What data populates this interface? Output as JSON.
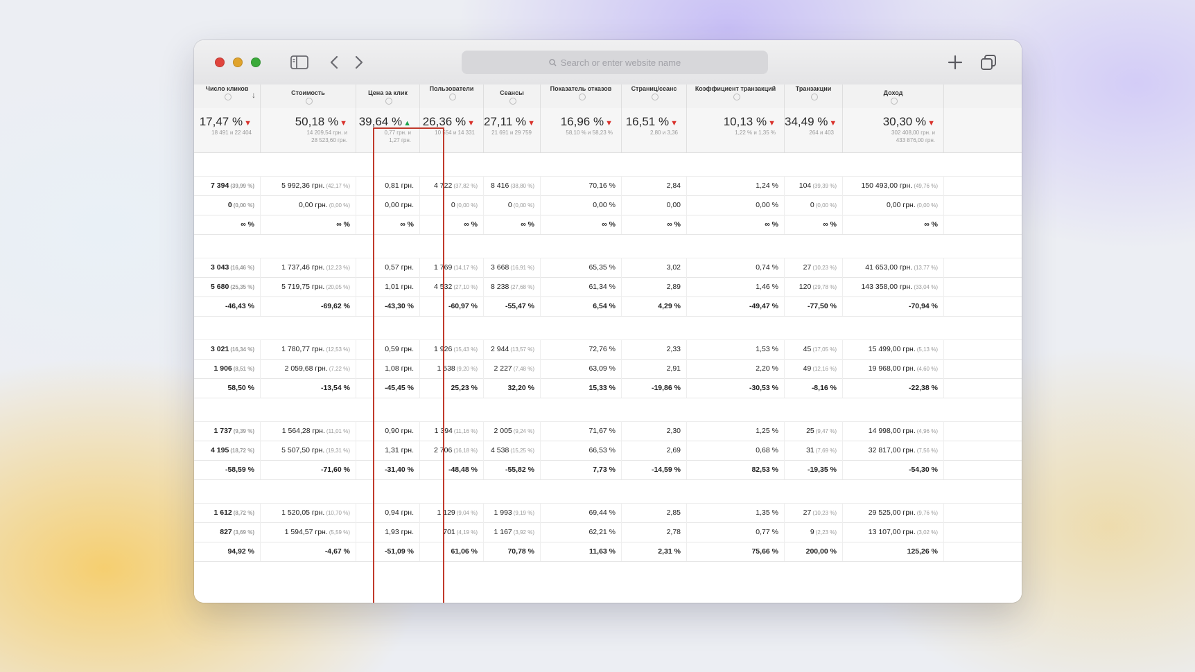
{
  "browser": {
    "address_placeholder": "Search or enter website name",
    "icons": [
      "sidebar-icon",
      "back-icon",
      "forward-icon",
      "plus-icon",
      "tabs-icon",
      "search-icon"
    ]
  },
  "table": {
    "columns": [
      {
        "key": "clicks",
        "label": "Число кликов"
      },
      {
        "key": "cost",
        "label": "Стоимость"
      },
      {
        "key": "cpc",
        "label": "Цена за клик"
      },
      {
        "key": "users",
        "label": "Пользователи"
      },
      {
        "key": "sessions",
        "label": "Сеансы"
      },
      {
        "key": "bounce",
        "label": "Показатель отказов"
      },
      {
        "key": "pages",
        "label": "Страниц/сеанс"
      },
      {
        "key": "conv",
        "label": "Коэффициент транзакций"
      },
      {
        "key": "trans",
        "label": "Транзакции"
      },
      {
        "key": "revenue",
        "label": "Доход"
      }
    ],
    "summary": [
      {
        "pct": "17,47 %",
        "dir": "down",
        "sub": [
          "18 491 и 22 404"
        ]
      },
      {
        "pct": "50,18 %",
        "dir": "down",
        "sub": [
          "14 209,54 грн. и",
          "28 523,60 грн."
        ]
      },
      {
        "pct": "39,64 %",
        "dir": "up",
        "sub": [
          "0,77 грн. и",
          "1,27 грн."
        ]
      },
      {
        "pct": "26,36 %",
        "dir": "down",
        "sub": [
          "10 554 и 14 331"
        ]
      },
      {
        "pct": "27,11 %",
        "dir": "down",
        "sub": [
          "21 691 и 29 759"
        ]
      },
      {
        "pct": "16,96 %",
        "dir": "down",
        "sub": [
          "58,10 % и 58,23 %"
        ]
      },
      {
        "pct": "16,51 %",
        "dir": "down",
        "sub": [
          "2,80 и 3,36"
        ]
      },
      {
        "pct": "10,13 %",
        "dir": "down",
        "sub": [
          "1,22 % и 1,35 %"
        ]
      },
      {
        "pct": "34,49 %",
        "dir": "down",
        "sub": [
          "264 и 403"
        ]
      },
      {
        "pct": "30,30 %",
        "dir": "down",
        "sub": [
          "302 408,00 грн. и",
          "433 876,00 грн."
        ]
      }
    ],
    "groups": [
      {
        "rows": [
          [
            [
              "7 394",
              "(39,99 %)"
            ],
            [
              "5 992,36 грн.",
              "(42,17 %)"
            ],
            [
              "0,81 грн.",
              ""
            ],
            [
              "4 722",
              "(37,82 %)"
            ],
            [
              "8 416",
              "(38,80 %)"
            ],
            [
              "70,16 %",
              ""
            ],
            [
              "2,84",
              ""
            ],
            [
              "1,24 %",
              ""
            ],
            [
              "104",
              "(39,39 %)"
            ],
            [
              "150 493,00 грн.",
              "(49,76 %)"
            ]
          ],
          [
            [
              "0",
              "(0,00 %)"
            ],
            [
              "0,00 грн.",
              "(0,00 %)"
            ],
            [
              "0,00 грн.",
              ""
            ],
            [
              "0",
              "(0,00 %)"
            ],
            [
              "0",
              "(0,00 %)"
            ],
            [
              "0,00 %",
              ""
            ],
            [
              "0,00",
              ""
            ],
            [
              "0,00 %",
              ""
            ],
            [
              "0",
              "(0,00 %)"
            ],
            [
              "0,00 грн.",
              "(0,00 %)"
            ]
          ],
          [
            [
              "∞ %",
              ""
            ],
            [
              "∞ %",
              ""
            ],
            [
              "∞ %",
              ""
            ],
            [
              "∞ %",
              ""
            ],
            [
              "∞ %",
              ""
            ],
            [
              "∞ %",
              ""
            ],
            [
              "∞ %",
              ""
            ],
            [
              "∞ %",
              ""
            ],
            [
              "∞ %",
              ""
            ],
            [
              "∞ %",
              ""
            ]
          ]
        ]
      },
      {
        "rows": [
          [
            [
              "3 043",
              "(16,46 %)"
            ],
            [
              "1 737,46 грн.",
              "(12,23 %)"
            ],
            [
              "0,57 грн.",
              ""
            ],
            [
              "1 769",
              "(14,17 %)"
            ],
            [
              "3 668",
              "(16,91 %)"
            ],
            [
              "65,35 %",
              ""
            ],
            [
              "3,02",
              ""
            ],
            [
              "0,74 %",
              ""
            ],
            [
              "27",
              "(10,23 %)"
            ],
            [
              "41 653,00 грн.",
              "(13,77 %)"
            ]
          ],
          [
            [
              "5 680",
              "(25,35 %)"
            ],
            [
              "5 719,75 грн.",
              "(20,05 %)"
            ],
            [
              "1,01 грн.",
              ""
            ],
            [
              "4 532",
              "(27,10 %)"
            ],
            [
              "8 238",
              "(27,68 %)"
            ],
            [
              "61,34 %",
              ""
            ],
            [
              "2,89",
              ""
            ],
            [
              "1,46 %",
              ""
            ],
            [
              "120",
              "(29,78 %)"
            ],
            [
              "143 358,00 грн.",
              "(33,04 %)"
            ]
          ],
          [
            [
              "-46,43 %",
              ""
            ],
            [
              "-69,62 %",
              ""
            ],
            [
              "-43,30 %",
              ""
            ],
            [
              "-60,97 %",
              ""
            ],
            [
              "-55,47 %",
              ""
            ],
            [
              "6,54 %",
              ""
            ],
            [
              "4,29 %",
              ""
            ],
            [
              "-49,47 %",
              ""
            ],
            [
              "-77,50 %",
              ""
            ],
            [
              "-70,94 %",
              ""
            ]
          ]
        ]
      },
      {
        "rows": [
          [
            [
              "3 021",
              "(16,34 %)"
            ],
            [
              "1 780,77 грн.",
              "(12,53 %)"
            ],
            [
              "0,59 грн.",
              ""
            ],
            [
              "1 926",
              "(15,43 %)"
            ],
            [
              "2 944",
              "(13,57 %)"
            ],
            [
              "72,76 %",
              ""
            ],
            [
              "2,33",
              ""
            ],
            [
              "1,53 %",
              ""
            ],
            [
              "45",
              "(17,05 %)"
            ],
            [
              "15 499,00 грн.",
              "(5,13 %)"
            ]
          ],
          [
            [
              "1 906",
              "(8,51 %)"
            ],
            [
              "2 059,68 грн.",
              "(7,22 %)"
            ],
            [
              "1,08 грн.",
              ""
            ],
            [
              "1 538",
              "(9,20 %)"
            ],
            [
              "2 227",
              "(7,48 %)"
            ],
            [
              "63,09 %",
              ""
            ],
            [
              "2,91",
              ""
            ],
            [
              "2,20 %",
              ""
            ],
            [
              "49",
              "(12,16 %)"
            ],
            [
              "19 968,00 грн.",
              "(4,60 %)"
            ]
          ],
          [
            [
              "58,50 %",
              ""
            ],
            [
              "-13,54 %",
              ""
            ],
            [
              "-45,45 %",
              ""
            ],
            [
              "25,23 %",
              ""
            ],
            [
              "32,20 %",
              ""
            ],
            [
              "15,33 %",
              ""
            ],
            [
              "-19,86 %",
              ""
            ],
            [
              "-30,53 %",
              ""
            ],
            [
              "-8,16 %",
              ""
            ],
            [
              "-22,38 %",
              ""
            ]
          ]
        ]
      },
      {
        "rows": [
          [
            [
              "1 737",
              "(9,39 %)"
            ],
            [
              "1 564,28 грн.",
              "(11,01 %)"
            ],
            [
              "0,90 грн.",
              ""
            ],
            [
              "1 394",
              "(11,16 %)"
            ],
            [
              "2 005",
              "(9,24 %)"
            ],
            [
              "71,67 %",
              ""
            ],
            [
              "2,30",
              ""
            ],
            [
              "1,25 %",
              ""
            ],
            [
              "25",
              "(9,47 %)"
            ],
            [
              "14 998,00 грн.",
              "(4,96 %)"
            ]
          ],
          [
            [
              "4 195",
              "(18,72 %)"
            ],
            [
              "5 507,50 грн.",
              "(19,31 %)"
            ],
            [
              "1,31 грн.",
              ""
            ],
            [
              "2 706",
              "(16,18 %)"
            ],
            [
              "4 538",
              "(15,25 %)"
            ],
            [
              "66,53 %",
              ""
            ],
            [
              "2,69",
              ""
            ],
            [
              "0,68 %",
              ""
            ],
            [
              "31",
              "(7,69 %)"
            ],
            [
              "32 817,00 грн.",
              "(7,56 %)"
            ]
          ],
          [
            [
              "-58,59 %",
              ""
            ],
            [
              "-71,60 %",
              ""
            ],
            [
              "-31,40 %",
              ""
            ],
            [
              "-48,48 %",
              ""
            ],
            [
              "-55,82 %",
              ""
            ],
            [
              "7,73 %",
              ""
            ],
            [
              "-14,59 %",
              ""
            ],
            [
              "82,53 %",
              ""
            ],
            [
              "-19,35 %",
              ""
            ],
            [
              "-54,30 %",
              ""
            ]
          ]
        ]
      },
      {
        "rows": [
          [
            [
              "1 612",
              "(8,72 %)"
            ],
            [
              "1 520,05 грн.",
              "(10,70 %)"
            ],
            [
              "0,94 грн.",
              ""
            ],
            [
              "1 129",
              "(9,04 %)"
            ],
            [
              "1 993",
              "(9,19 %)"
            ],
            [
              "69,44 %",
              ""
            ],
            [
              "2,85",
              ""
            ],
            [
              "1,35 %",
              ""
            ],
            [
              "27",
              "(10,23 %)"
            ],
            [
              "29 525,00 грн.",
              "(9,76 %)"
            ]
          ],
          [
            [
              "827",
              "(3,69 %)"
            ],
            [
              "1 594,57 грн.",
              "(5,59 %)"
            ],
            [
              "1,93 грн.",
              ""
            ],
            [
              "701",
              "(4,19 %)"
            ],
            [
              "1 167",
              "(3,92 %)"
            ],
            [
              "62,21 %",
              ""
            ],
            [
              "2,78",
              ""
            ],
            [
              "0,77 %",
              ""
            ],
            [
              "9",
              "(2,23 %)"
            ],
            [
              "13 107,00 грн.",
              "(3,02 %)"
            ]
          ],
          [
            [
              "94,92 %",
              ""
            ],
            [
              "-4,67 %",
              ""
            ],
            [
              "-51,09 %",
              ""
            ],
            [
              "61,06 %",
              ""
            ],
            [
              "70,78 %",
              ""
            ],
            [
              "11,63 %",
              ""
            ],
            [
              "2,31 %",
              ""
            ],
            [
              "75,66 %",
              ""
            ],
            [
              "200,00 %",
              ""
            ],
            [
              "125,26 %",
              ""
            ]
          ]
        ]
      }
    ]
  }
}
